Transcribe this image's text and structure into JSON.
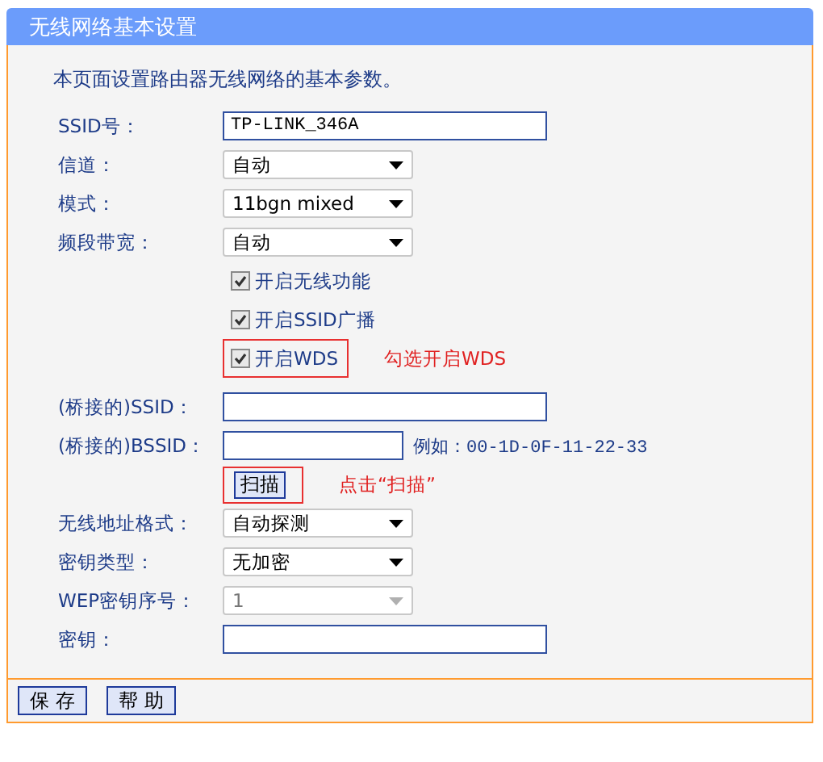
{
  "title": "无线网络基本设置",
  "intro": "本页面设置路由器无线网络的基本参数。",
  "basic": [
    {
      "kind": "text",
      "label": "SSID号：",
      "value": "TP-LINK_346A"
    },
    {
      "kind": "select",
      "label": "信道：",
      "value": "自动",
      "disabled": false
    },
    {
      "kind": "select",
      "label": "模式：",
      "value": "11bgn mixed",
      "disabled": false
    },
    {
      "kind": "select",
      "label": "频段带宽：",
      "value": "自动",
      "disabled": false
    },
    {
      "kind": "checkbox",
      "label": "开启无线功能",
      "checked": true
    },
    {
      "kind": "checkbox",
      "label": "开启SSID广播",
      "checked": true
    },
    {
      "kind": "checkbox",
      "label": "开启WDS",
      "checked": true,
      "annotation": "勾选开启WDS"
    }
  ],
  "wds": [
    {
      "kind": "text",
      "label": "(桥接的)SSID："
    },
    {
      "kind": "text",
      "label": "(桥接的)BSSID：",
      "example": "例如：00-1D-0F-11-22-33"
    },
    {
      "kind": "button",
      "text": "扫描",
      "annotation": "点击“扫描”"
    },
    {
      "kind": "select",
      "label": "无线地址格式：",
      "value": "自动探测",
      "disabled": false
    },
    {
      "kind": "select",
      "label": "密钥类型：",
      "value": "无加密",
      "disabled": false
    },
    {
      "kind": "select",
      "label": "WEP密钥序号：",
      "value": "1",
      "disabled": true
    },
    {
      "kind": "text",
      "label": "密钥："
    }
  ],
  "buttons": [
    "保 存",
    "帮 助"
  ]
}
